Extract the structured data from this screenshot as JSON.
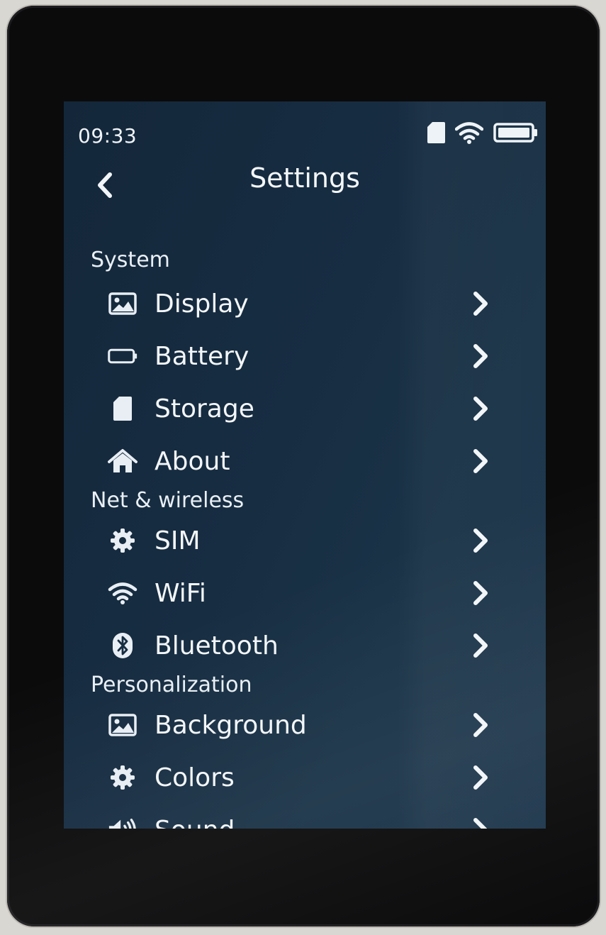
{
  "status_bar": {
    "time": "09:33",
    "icons": [
      "sd-card-icon",
      "wifi-icon",
      "battery-icon"
    ]
  },
  "header": {
    "title": "Settings",
    "back_icon": "chevron-left-icon"
  },
  "sections": [
    {
      "label": "System",
      "items": [
        {
          "label": "Display",
          "icon": "image-icon"
        },
        {
          "label": "Battery",
          "icon": "battery-icon"
        },
        {
          "label": "Storage",
          "icon": "sd-card-icon"
        },
        {
          "label": "About",
          "icon": "home-icon"
        }
      ]
    },
    {
      "label": "Net & wireless",
      "items": [
        {
          "label": "SIM",
          "icon": "gear-icon"
        },
        {
          "label": "WiFi",
          "icon": "wifi-icon"
        },
        {
          "label": "Bluetooth",
          "icon": "bluetooth-icon"
        }
      ]
    },
    {
      "label": "Personalization",
      "items": [
        {
          "label": "Background",
          "icon": "image-icon"
        },
        {
          "label": "Colors",
          "icon": "gear-icon"
        },
        {
          "label": "Sound",
          "icon": "speaker-icon"
        }
      ]
    }
  ],
  "colors": {
    "screen_bg": "#172d42",
    "text": "#f3f6f9",
    "icon": "#e8eef4"
  }
}
